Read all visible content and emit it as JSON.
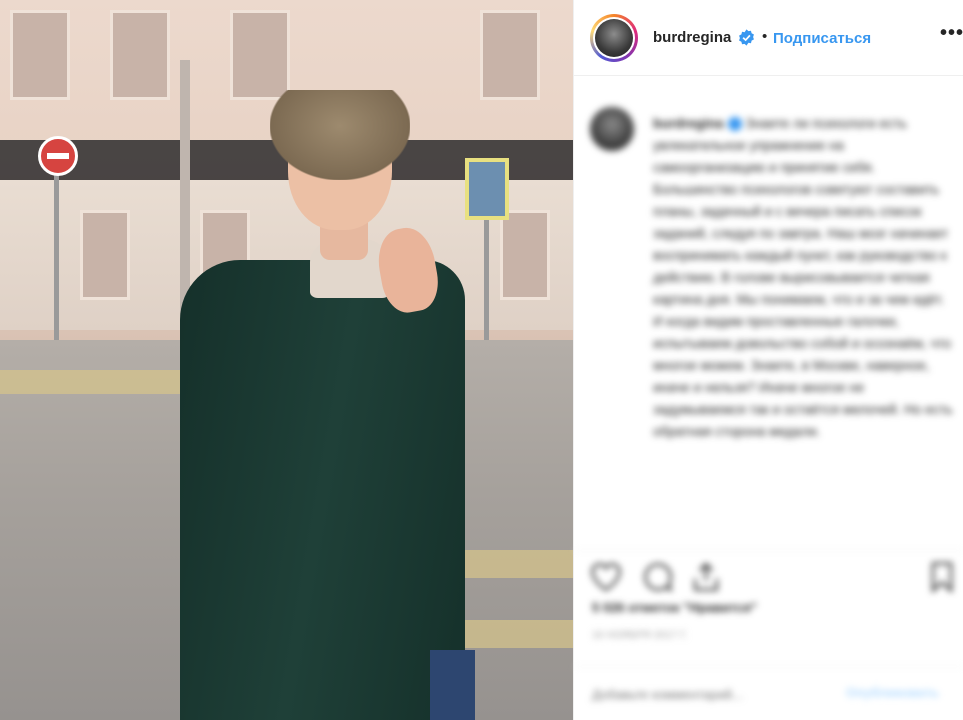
{
  "post": {
    "username": "burdregina",
    "dot": "•",
    "follow_label": "Подписаться",
    "more_label": "•••"
  },
  "caption": {
    "username": "burdregina",
    "text": "Знаете ли психологи есть увлекательное упражнение на самоорганизацию и принятие себя. Большинство психологов советуют составить планы, зaдачный и с вечера писать список заданий, следуя по завтра. Наш мозг начинает воспринимать каждый пункт, как руководство к действию. В голове вырисовывается четкая картина дня. Мы понимаем, что и за чем идёт. И когда видим проставленные галочки, испытываем довольство собой и осознаём, что многое можем. Знаете, в Москве, наверное, иначе и нельзя? Иначе многое не задумываемся так и остаётся мелочей. Но есть обратная сторона медали."
  },
  "likes_text": "5 026 отметок \"Нравится\"",
  "timestamp": "16 НОЯБРЯ 2017 Г.",
  "comment": {
    "placeholder": "Добавьте комментарий...",
    "publish_label": "Опубликовать"
  },
  "colors": {
    "accent": "#3897f0",
    "text": "#262626",
    "muted": "#999999",
    "border": "#efefef"
  },
  "icons": [
    "heart-icon",
    "comment-icon",
    "share-icon",
    "bookmark-icon",
    "verified-badge-icon",
    "more-options-icon"
  ]
}
